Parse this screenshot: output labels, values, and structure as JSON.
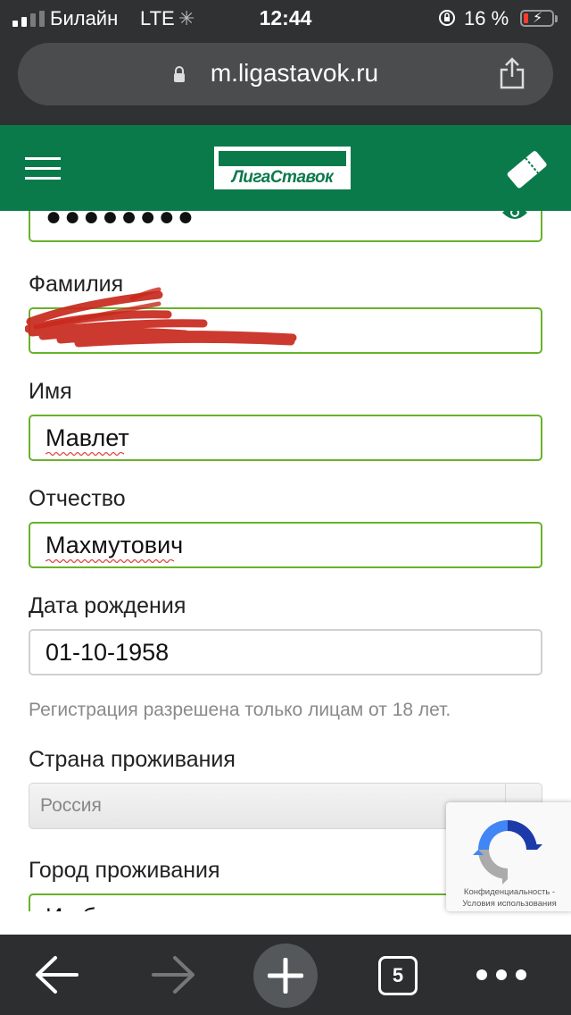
{
  "status_bar": {
    "carrier": "Билайн",
    "network": "LTE",
    "time": "12:44",
    "battery_percent": "16 %",
    "battery_level": 0.16
  },
  "browser": {
    "url": "m.ligastavok.ru",
    "tab_count": "5"
  },
  "header": {
    "logo_text": "ЛигаСтавок",
    "brand_color": "#0b7a4b"
  },
  "form": {
    "password": {
      "masked_value": "●●●●●●●●"
    },
    "last_name": {
      "label": "Фамилия",
      "value": ""
    },
    "first_name": {
      "label": "Имя",
      "value": "Мавлет"
    },
    "patronymic": {
      "label": "Отчество",
      "value": "Махмутович"
    },
    "birth_date": {
      "label": "Дата рождения",
      "value": "01-10-1958",
      "hint": "Регистрация разрешена только лицам от 18 лет."
    },
    "country": {
      "label": "Страна проживания",
      "value": "Россия"
    },
    "city": {
      "label": "Город проживания",
      "value": "Ишбулды"
    },
    "input_border_color": "#68b228"
  },
  "recaptcha": {
    "privacy": "Конфиденциальность",
    "separator": "-",
    "terms": "Условия использования"
  },
  "icons": {
    "hamburger": "menu-icon",
    "coupon": "coupon-icon",
    "eye": "eye-icon",
    "share": "share-icon",
    "back": "arrow-left-icon",
    "forward": "arrow-right-icon",
    "new_tab": "plus-icon",
    "more": "more-dots-icon"
  }
}
